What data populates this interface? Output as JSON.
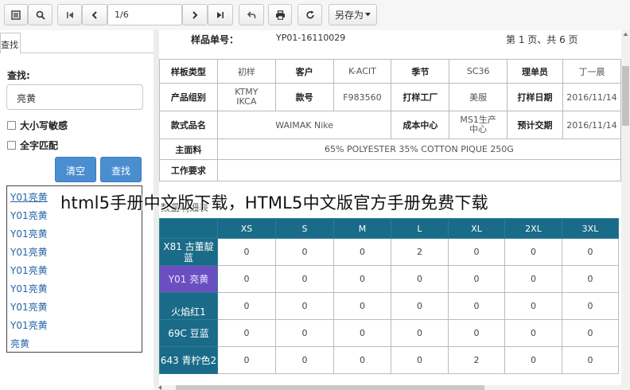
{
  "toolbar": {
    "page_value": "1/6",
    "saveas_label": "另存为",
    "icons": [
      "sidebar-toggle-icon",
      "search-icon",
      "first-page-icon",
      "prev-page-icon",
      "next-page-icon",
      "last-page-icon",
      "back-icon",
      "print-icon",
      "refresh-icon"
    ]
  },
  "sidebar": {
    "tab_label": "查找",
    "find_label": "查找:",
    "find_value": "亮黄",
    "case_label": "大小写敏感",
    "whole_label": "全字匹配",
    "clear_label": "清空",
    "search_label": "查找",
    "results": [
      "Y01亮黄",
      "Y01亮黄",
      "Y01亮黄",
      "Y01亮黄",
      "Y01亮黄",
      "Y01亮黄",
      "Y01亮黄",
      "Y01亮黄",
      "亮黄"
    ]
  },
  "doc": {
    "sample_no_label": "样品单号：",
    "sample_no_value": "YP01-16110029",
    "page_info": "第 1 页、共 6 页",
    "info": {
      "row1": [
        "样板类型",
        "初样",
        "客户",
        "K-ACIT",
        "季节",
        "SC36",
        "理单员",
        "丁一晨"
      ],
      "row2": [
        "产品组别",
        "KTMY IKCA",
        "款号",
        "F983560",
        "打样工厂",
        "美服",
        "打样日期",
        "2016/11/14"
      ],
      "row3": [
        "款式品名",
        "WAIMAK Nike",
        "成本中心",
        "MS1生产 中心",
        "预计交期",
        "2016/11/14"
      ],
      "row4": [
        "主面料",
        "65% POLYESTER 35% COTTON PIQUE 250G"
      ],
      "row5": [
        "工作要求",
        ""
      ]
    },
    "qty_title": "数量明细表",
    "sizes": [
      "XS",
      "S",
      "M",
      "L",
      "XL",
      "2XL",
      "3XL"
    ],
    "colors": [
      {
        "name": "X81 古董靛蓝",
        "values": [
          "0",
          "0",
          "0",
          "2",
          "0",
          "0",
          "0"
        ]
      },
      {
        "name": "Y01 亮黄",
        "values": [
          "0",
          "0",
          "0",
          "0",
          "0",
          "0",
          "0"
        ]
      },
      {
        "name": "火焰红1",
        "values": [
          "0",
          "0",
          "0",
          "0",
          "0",
          "0",
          "0"
        ]
      },
      {
        "name": "69C 豆蓝",
        "values": [
          "0",
          "0",
          "0",
          "0",
          "0",
          "0",
          "0"
        ]
      },
      {
        "name": "643 青柠色2",
        "values": [
          "0",
          "0",
          "0",
          "0",
          "2",
          "0",
          "0"
        ]
      }
    ]
  },
  "watermark": "html5手册中文版下载，HTML5中文版官方手册免费下载",
  "colors": {
    "header_teal": "#1a6b88",
    "highlight_purple": "#6b4fc0",
    "button_blue": "#4a8ed0",
    "link_blue": "#2464a8"
  }
}
